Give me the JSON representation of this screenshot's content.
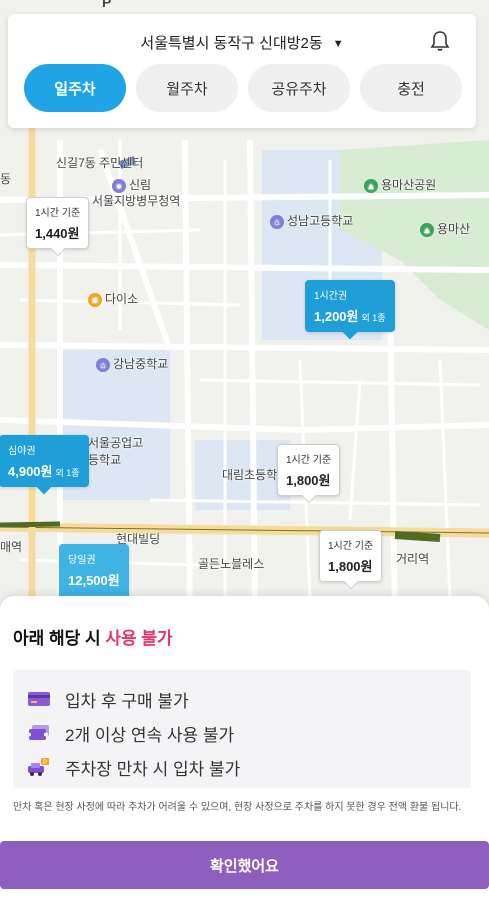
{
  "header": {
    "location": "서울특별시 동작구 신대방2동",
    "tabs": [
      {
        "label": "일주차",
        "active": true
      },
      {
        "label": "월주차",
        "active": false
      },
      {
        "label": "공유주차",
        "active": false
      },
      {
        "label": "충전",
        "active": false
      }
    ]
  },
  "map": {
    "pois": [
      {
        "name": "신길7동 주민센터"
      },
      {
        "name": "신림"
      },
      {
        "name": "서울지방병무청역"
      },
      {
        "name": "성남고등학교"
      },
      {
        "name": "용마산공원"
      },
      {
        "name": "용마산"
      },
      {
        "name": "다이소"
      },
      {
        "name": "강남중학교"
      },
      {
        "name": "서울공업고등학교"
      },
      {
        "name": "대림초등학교"
      },
      {
        "name": "현대빌딩"
      },
      {
        "name": "골든노블레스"
      },
      {
        "name": "거리역"
      },
      {
        "name": "동"
      },
      {
        "name": "매역"
      },
      {
        "name": "P"
      }
    ],
    "markers": [
      {
        "label": "1시간 기준",
        "price": "1,440원",
        "extra": ""
      },
      {
        "label": "1시간권",
        "price": "1,200원",
        "extra": "외 1종"
      },
      {
        "label": "심야권",
        "price": "4,900원",
        "extra": "외 1종"
      },
      {
        "label": "1시간 기준",
        "price": "1,800원",
        "extra": ""
      },
      {
        "label": "1시간 기준",
        "price": "1,800원",
        "extra": ""
      },
      {
        "label": "당일권",
        "price": "12,500원",
        "extra": ""
      }
    ]
  },
  "sheet": {
    "title_prefix": "아래 해당 시 ",
    "title_highlight": "사용 불가",
    "rules": [
      {
        "text": "입차 후 구매 불가",
        "icon": "credit-card-icon"
      },
      {
        "text": "2개 이상 연속 사용 불가",
        "icon": "tickets-icon"
      },
      {
        "text": "주차장 만차 시 입차 불가",
        "icon": "car-parking-icon"
      }
    ],
    "note": "만차 혹은 현장 사정에 따라 주차가 어려울 수 있으며, 현장 사정으로 주차를 하지 못한 경우 전액 환불 됩니다.",
    "confirm_label": "확인했어요"
  },
  "colors": {
    "accent": "#1fa5e5",
    "highlight": "#e7336b",
    "confirm": "#8f5fbf"
  }
}
